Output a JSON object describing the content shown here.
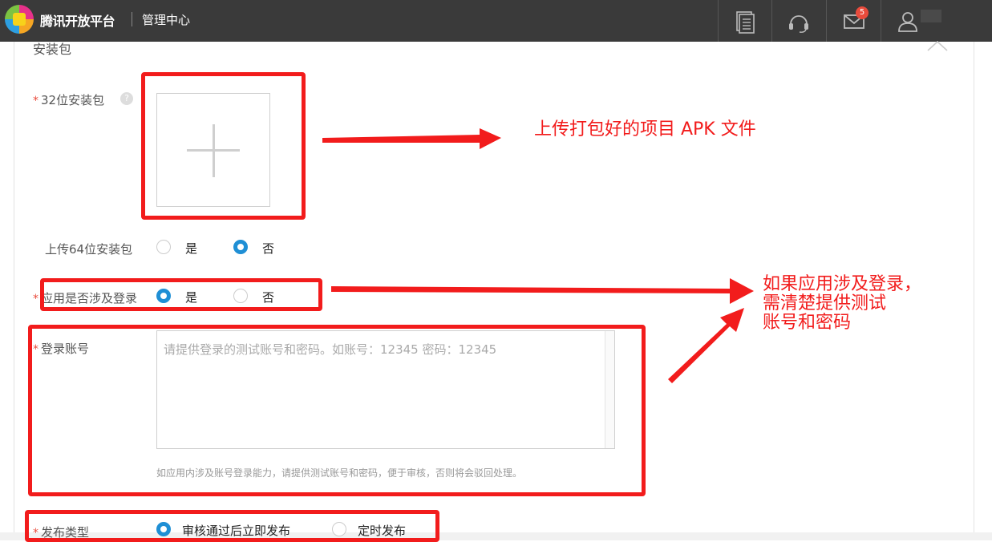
{
  "header": {
    "brand": "腾讯开放平台",
    "subtitle": "管理中心",
    "mail_badge": "5",
    "icons": [
      "docs-icon",
      "support-headset-icon",
      "mail-icon",
      "user-icon"
    ]
  },
  "section": {
    "title": "安装包"
  },
  "form": {
    "package32": {
      "required": "*",
      "label": "32位安装包",
      "help": "?"
    },
    "upload64": {
      "label": "上传64位安装包",
      "options": [
        "是",
        "否"
      ],
      "selected": "否"
    },
    "login": {
      "required": "*",
      "label": "应用是否涉及登录",
      "options": [
        "是",
        "否"
      ],
      "selected": "是"
    },
    "account": {
      "required": "*",
      "label": "登录账号",
      "placeholder": "请提供登录的测试账号和密码。如账号：12345 密码：12345",
      "hint": "如应用内涉及账号登录能力，请提供测试账号和密码，便于审核，否则将会驳回处理。"
    },
    "publish": {
      "required": "*",
      "label": "发布类型",
      "options": [
        "审核通过后立即发布",
        "定时发布"
      ],
      "selected": "审核通过后立即发布"
    }
  },
  "annotations": {
    "upload_note": "上传打包好的项目 APK 文件",
    "login_note": [
      "如果应用涉及登录，",
      "需清楚提供测试",
      "账号和密码"
    ],
    "color": "#f21c1c"
  },
  "colors": {
    "topbar": "#3a3a3a",
    "accent": "#1f8fd5",
    "required": "#e94b3c"
  }
}
